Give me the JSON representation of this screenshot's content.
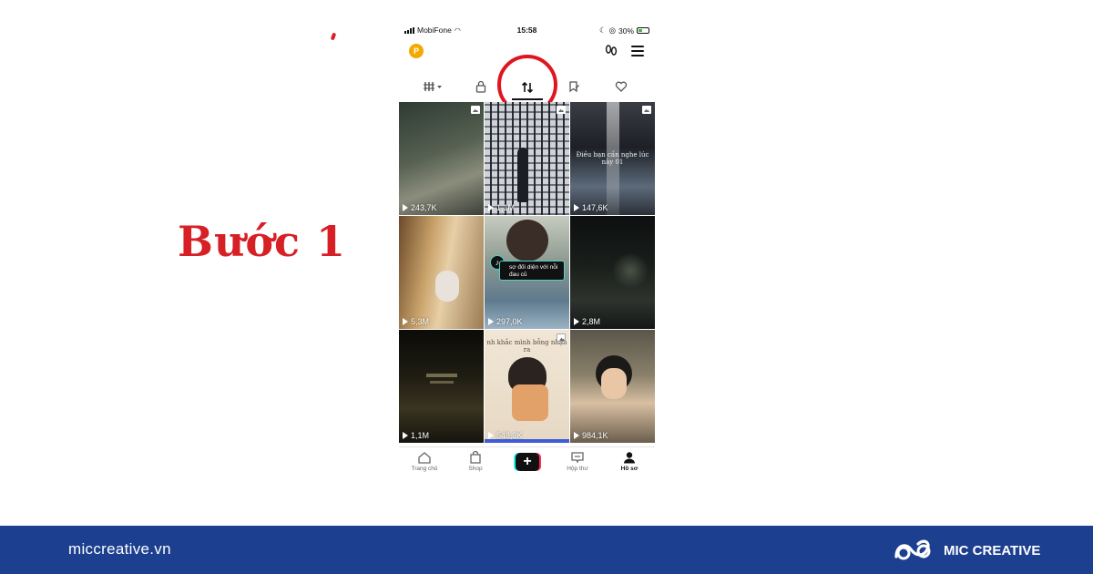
{
  "annotation": {
    "step_label": "Bước 1",
    "accent_color": "#d71f26"
  },
  "phone": {
    "status": {
      "carrier": "MobiFone",
      "time": "15:58",
      "battery": "30%"
    },
    "header": {
      "coin_letter": "P",
      "icons": [
        "coin-icon",
        "footprint-icon",
        "menu-icon"
      ]
    },
    "tabs": [
      {
        "name": "videos-grid",
        "icon": "grid-icon",
        "active": false
      },
      {
        "name": "private",
        "icon": "lock-icon",
        "active": false
      },
      {
        "name": "reposts",
        "icon": "repost-icon",
        "active": true
      },
      {
        "name": "favorites",
        "icon": "bookmark-icon",
        "active": false
      },
      {
        "name": "liked",
        "icon": "heart-icon",
        "active": false
      }
    ],
    "videos": [
      {
        "views": "243,7K",
        "photo": true,
        "caption": ""
      },
      {
        "views": "1,1M",
        "photo": true,
        "caption": ""
      },
      {
        "views": "147,6K",
        "photo": true,
        "caption": "Điều bạn cần nghe lúc này 01"
      },
      {
        "views": "5,3M",
        "photo": false,
        "caption": ""
      },
      {
        "views": "297,0K",
        "photo": false,
        "caption": "",
        "sticker": "sợ đối diện với nỗi đau cũ"
      },
      {
        "views": "2,8M",
        "photo": false,
        "caption": ""
      },
      {
        "views": "1,1M",
        "photo": false,
        "caption": ""
      },
      {
        "views": "548,3K",
        "photo": true,
        "caption": "nh khắc mình bỗng nhận ra"
      },
      {
        "views": "984,1K",
        "photo": false,
        "caption": ""
      }
    ],
    "bottom_nav": {
      "home": "Trang chủ",
      "shop": "Shop",
      "inbox": "Hộp thư",
      "profile": "Hồ sơ"
    }
  },
  "footer": {
    "website": "miccreative.vn",
    "brand": "MIC CREATIVE",
    "color": "#1c3f8f"
  }
}
